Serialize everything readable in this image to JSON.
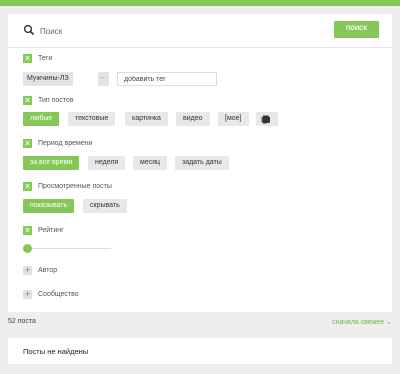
{
  "search": {
    "placeholder": "Поиск",
    "button": "ПОИСК"
  },
  "tags": {
    "label": "Теги",
    "items": [
      "Мужчины-ЛЗ"
    ],
    "more": "···",
    "input_placeholder": "добавить тег"
  },
  "post_types": {
    "label": "Тип постов",
    "options": [
      "любые",
      "текстовые",
      "картинка",
      "видео",
      "[мое]"
    ],
    "selected": "любые",
    "extra_icon": "photo-stack-icon"
  },
  "period": {
    "label": "Период времени",
    "options": [
      "за все время",
      "неделя",
      "месяц",
      "задать даты"
    ],
    "selected": "за все время"
  },
  "viewed": {
    "label": "Просмотренные посты",
    "options": [
      "показывать",
      "скрывать"
    ],
    "selected": "показывать"
  },
  "rating": {
    "label": "Рейтинг",
    "value": 0
  },
  "author": {
    "label": "Автор"
  },
  "community": {
    "label": "Сообщество"
  },
  "results": {
    "count": "52 поста",
    "sort": "сначала свежее",
    "empty": "Посты не найдены"
  },
  "colors": {
    "accent": "#86c857",
    "background": "#eeeeee"
  }
}
